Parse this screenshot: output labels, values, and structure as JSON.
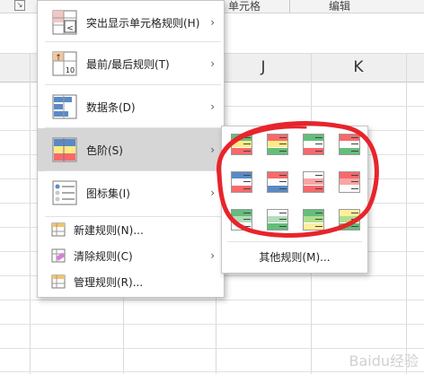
{
  "ribbon": {
    "group_cells": "单元格",
    "group_edit": "编辑"
  },
  "columns": [
    "J",
    "K"
  ],
  "menu": {
    "items": [
      {
        "label": "突出显示单元格规则(H)",
        "icon": "highlight-cells-rules-icon"
      },
      {
        "label": "最前/最后规则(T)",
        "icon": "top-bottom-rules-icon"
      },
      {
        "label": "数据条(D)",
        "icon": "data-bars-icon"
      },
      {
        "label": "色阶(S)",
        "icon": "color-scales-icon"
      },
      {
        "label": "图标集(I)",
        "icon": "icon-sets-icon"
      },
      {
        "label": "新建规则(N)...",
        "icon": "new-rule-icon"
      },
      {
        "label": "清除规则(C)",
        "icon": "clear-rules-icon"
      },
      {
        "label": "管理规则(R)...",
        "icon": "manage-rules-icon"
      }
    ]
  },
  "submenu": {
    "more_label": "其他规则(M)...",
    "scales": [
      [
        "#63be7b",
        "#ffeb84",
        "#f8696b"
      ],
      [
        "#f8696b",
        "#ffeb84",
        "#63be7b"
      ],
      [
        "#63be7b",
        "#fcfcff",
        "#f8696b"
      ],
      [
        "#f8696b",
        "#fcfcff",
        "#63be7b"
      ],
      [
        "#5a8ac6",
        "#fcfcff",
        "#f8696b"
      ],
      [
        "#f8696b",
        "#fcfcff",
        "#5a8ac6"
      ],
      [
        "#fcfcff",
        "#f8a5a6",
        "#f8696b"
      ],
      [
        "#f8696b",
        "#f8a5a6",
        "#fcfcff"
      ],
      [
        "#63be7b",
        "#b1ddb9",
        "#fcfcff"
      ],
      [
        "#fcfcff",
        "#b1ddb9",
        "#63be7b"
      ],
      [
        "#63be7b",
        "#b1dd8e",
        "#ffef9c"
      ],
      [
        "#ffef9c",
        "#b1dd8e",
        "#63be7b"
      ]
    ]
  },
  "colors": {
    "highlight_ellipse": "#e8242b",
    "selected_item_bg": "#d6d6d6"
  },
  "watermark": "Baidu经验"
}
